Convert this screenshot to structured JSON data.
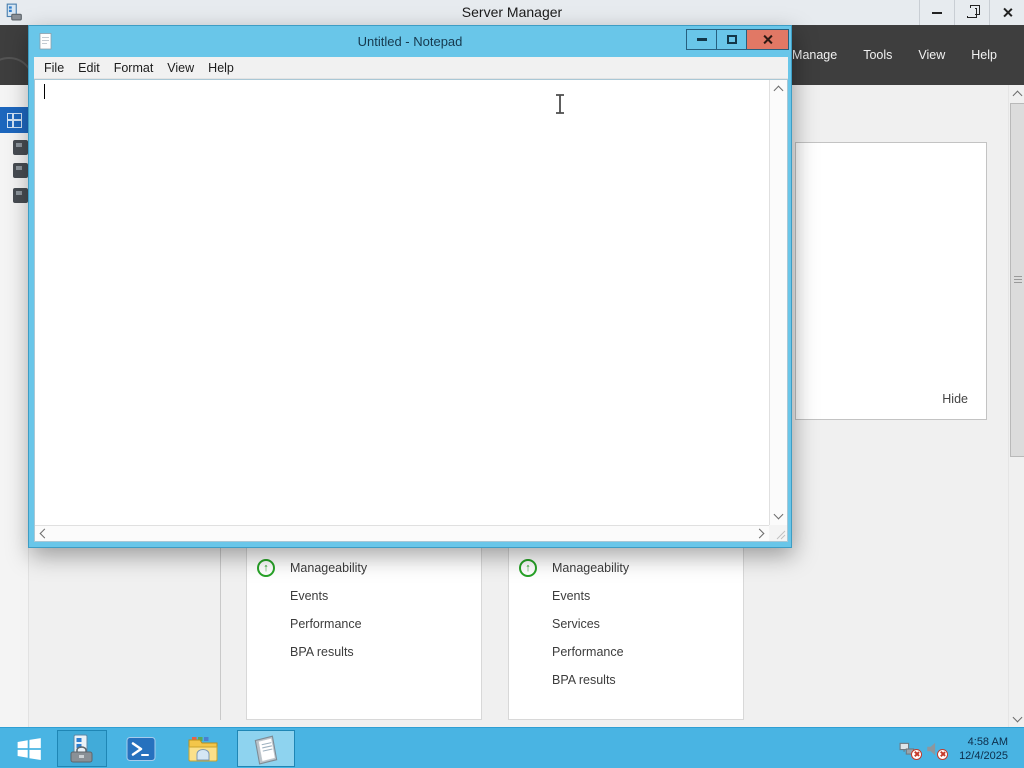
{
  "colors": {
    "taskbar_blue": "#49b4e3",
    "notepad_frame_blue": "#69c6e9",
    "close_button_red": "#e17865",
    "banner_dark": "#3e3e3e",
    "selected_nav_blue": "#1d66bd",
    "status_green": "#27a327"
  },
  "server_manager": {
    "window_title": "Server Manager",
    "menu_items": [
      "Manage",
      "Tools",
      "View",
      "Help"
    ],
    "hide_button_label": "Hide",
    "tiles": [
      {
        "rows": [
          "Manageability",
          "Events",
          "Performance",
          "BPA results"
        ]
      },
      {
        "rows": [
          "Manageability",
          "Events",
          "Services",
          "Performance",
          "BPA results"
        ]
      }
    ]
  },
  "notepad": {
    "window_title": "Untitled - Notepad",
    "menu_items": [
      "File",
      "Edit",
      "Format",
      "View",
      "Help"
    ],
    "text_content": ""
  },
  "taskbar": {
    "clock_time": "4:58 AM",
    "clock_date": "12/4/2025"
  },
  "icons": {
    "status_up_arrow": "↑"
  }
}
